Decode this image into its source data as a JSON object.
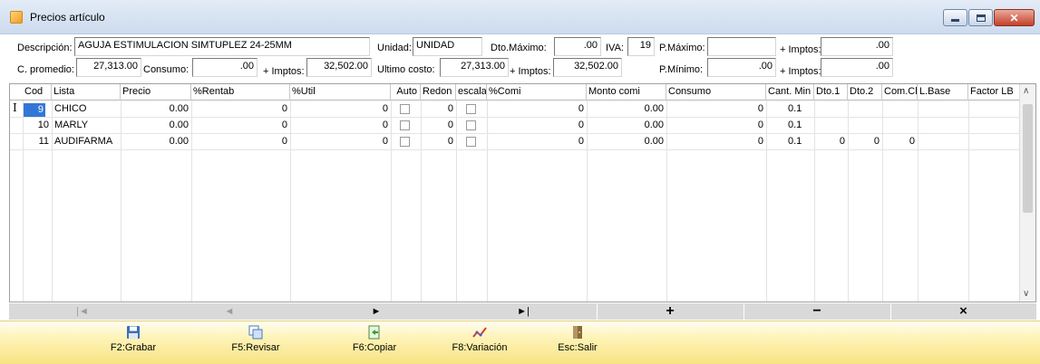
{
  "window": {
    "title": "Precios artículo"
  },
  "form": {
    "descripcion_label": "Descripción:",
    "descripcion_value": "AGUJA ESTIMULACION SIMTUPLEZ 24-25MM",
    "unidad_label": "Unidad:",
    "unidad_value": "UNIDAD",
    "dto_maximo_label": "Dto.Máximo:",
    "dto_maximo_value": ".00",
    "iva_label": "IVA:",
    "iva_value": "19",
    "p_maximo_label": "P.Máximo:",
    "p_maximo_value": "",
    "impuestos_label_1": "+ Imptos:",
    "impuestos_value_1": ".00",
    "c_promedio_label": "C. promedio:",
    "c_promedio_value": "27,313.00",
    "consumo_label": "Consumo:",
    "consumo_value": ".00",
    "impuestos_label_2": "+ Imptos:",
    "impuestos_value_2": "32,502.00",
    "ultimo_costo_label": "Ultimo costo:",
    "ultimo_costo_value": "27,313.00",
    "impuestos_label_3": "+ Imptos:",
    "impuestos_value_3": "32,502.00",
    "p_minimo_label": "P.Mínimo:",
    "p_minimo_value": ".00",
    "impuestos_label_4": "+ Imptos:",
    "impuestos_value_4": ".00"
  },
  "grid": {
    "headers": [
      "Cod",
      "Lista",
      "Precio",
      "%Rentab",
      "%Util",
      "Auto",
      "Redon",
      "escala",
      "%Comi",
      "Monto comi",
      "Consumo",
      "Cant. Min",
      "Dto.1",
      "Dto.2",
      "Com.Cl",
      "L.Base",
      "Factor LB"
    ],
    "rows": [
      {
        "cod": "9",
        "lista": "CHICO",
        "precio": "0.00",
        "rentab": "0",
        "util": "0",
        "redon": "0",
        "comi": "0",
        "monto_comi": "0.00",
        "consumo": "0",
        "cant_min": "0.1",
        "dto1": "",
        "dto2": "",
        "comcl": ""
      },
      {
        "cod": "10",
        "lista": "MARLY",
        "precio": "0.00",
        "rentab": "0",
        "util": "0",
        "redon": "0",
        "comi": "0",
        "monto_comi": "0.00",
        "consumo": "0",
        "cant_min": "0.1",
        "dto1": "",
        "dto2": "",
        "comcl": ""
      },
      {
        "cod": "11",
        "lista": "AUDIFARMA",
        "precio": "0.00",
        "rentab": "0",
        "util": "0",
        "redon": "0",
        "comi": "0",
        "monto_comi": "0.00",
        "consumo": "0",
        "cant_min": "0.1",
        "dto1": "0",
        "dto2": "0",
        "comcl": "0"
      }
    ],
    "cursor_glyph": "I"
  },
  "nav": {
    "first": "|◄",
    "prev": "◄",
    "next": "►",
    "last": "►|",
    "add": "+",
    "delete": "−",
    "cancel": "×"
  },
  "toolbar": {
    "grabar": "F2:Grabar",
    "revisar": "F5:Revisar",
    "copiar": "F6:Copiar",
    "variacion": "F8:Variación",
    "salir": "Esc:Salir"
  },
  "icons": [
    "app-icon",
    "minimize-icon",
    "maximize-icon",
    "close-icon",
    "save-icon",
    "review-icon",
    "copy-icon",
    "variation-icon",
    "exit-icon"
  ],
  "colors": {
    "titlebar": "#d6e2f2",
    "toolbar": "#fdf0a8",
    "selected_cell": "#3377d6",
    "navbar": "#d9d9d9"
  }
}
